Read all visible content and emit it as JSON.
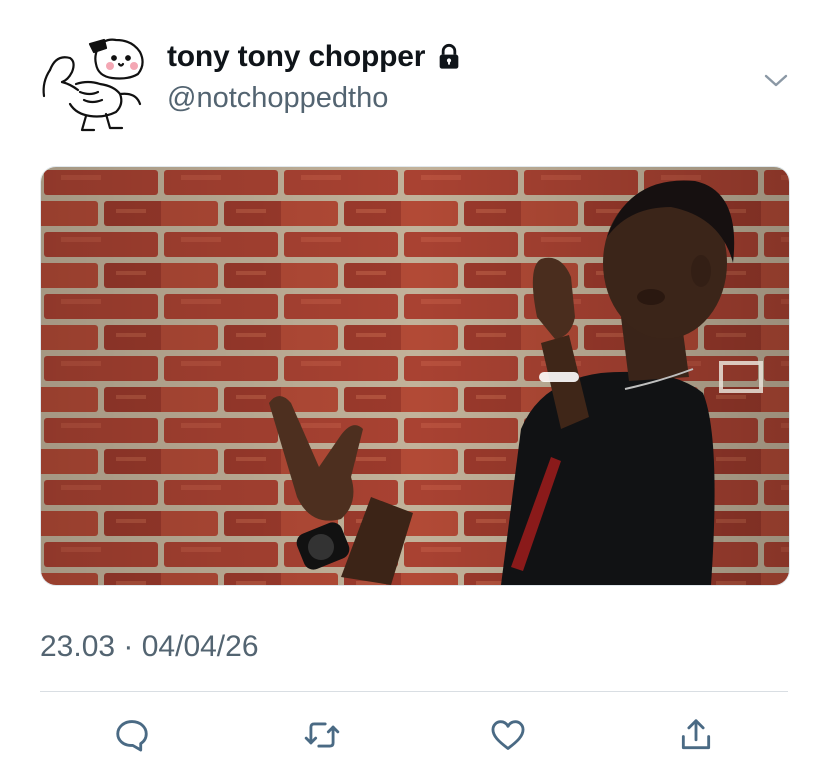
{
  "tweet": {
    "author": {
      "display_name": "tony tony chopper",
      "handle": "@notchoppedtho",
      "protected_icon": "lock-icon",
      "avatar": "avatar-pixel-muscular-dog-doodle"
    },
    "more_icon": "chevron-down-icon",
    "media": {
      "description_icon": "photo-man-talking-to-brick-wall"
    },
    "timestamp": "23.03 · 04/04/26",
    "actions": [
      {
        "name": "reply",
        "icon": "reply-icon"
      },
      {
        "name": "retweet",
        "icon": "retweet-icon"
      },
      {
        "name": "like",
        "icon": "heart-icon"
      },
      {
        "name": "share",
        "icon": "share-icon"
      }
    ]
  },
  "colors": {
    "text_primary": "#0f1419",
    "text_secondary": "#536471",
    "icon": "#4a6a84",
    "divider": "#d9dee3",
    "brick": "#a63a2c",
    "mortar": "#c9b9a0"
  }
}
